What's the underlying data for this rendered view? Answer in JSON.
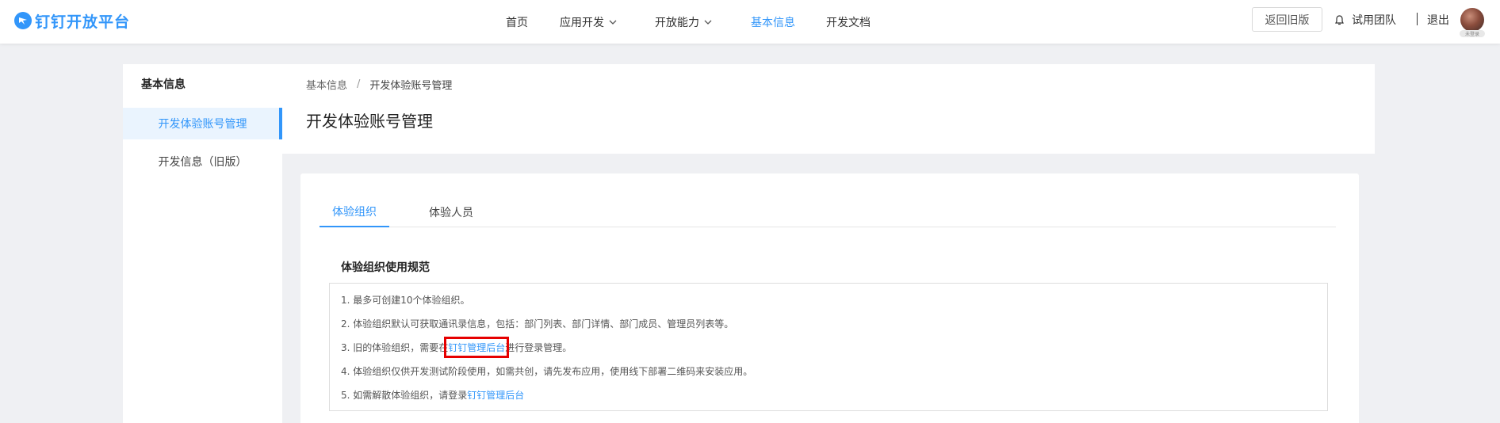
{
  "header": {
    "logo_text": "钉钉开放平台",
    "nav": [
      {
        "label": "首页",
        "dropdown": false,
        "active": false
      },
      {
        "label": "应用开发",
        "dropdown": true,
        "active": false
      },
      {
        "label": "开放能力",
        "dropdown": true,
        "active": false
      },
      {
        "label": "基本信息",
        "dropdown": false,
        "active": true
      },
      {
        "label": "开发文档",
        "dropdown": false,
        "active": false
      }
    ],
    "back_button": "返回旧版",
    "team_label": "试用团队",
    "logout_label": "退出",
    "avatar_tag": "未登录"
  },
  "sidebar": {
    "title": "基本信息",
    "items": [
      {
        "label": "开发体验账号管理",
        "active": true
      },
      {
        "label": "开发信息（旧版）",
        "active": false
      }
    ]
  },
  "page": {
    "breadcrumb": [
      "基本信息",
      "开发体验账号管理"
    ],
    "breadcrumb_separator": "/",
    "title": "开发体验账号管理"
  },
  "tabs": [
    {
      "label": "体验组织",
      "active": true
    },
    {
      "label": "体验人员",
      "active": false
    }
  ],
  "rules": {
    "title": "体验组织使用规范",
    "items": [
      {
        "text_before": "1. 最多可创建10个体验组织。",
        "link": "",
        "text_after": ""
      },
      {
        "text_before": "2. 体验组织默认可获取通讯录信息，包括：部门列表、部门详情、部门成员、管理员列表等。",
        "link": "",
        "text_after": ""
      },
      {
        "text_before": "3. 旧的体验组织，需要在",
        "link": "钉钉管理后台",
        "text_after": "进行登录管理。"
      },
      {
        "text_before": "4. 体验组织仅供开发测试阶段使用，如需共创，请先发布应用，使用线下部署二维码来安装应用。",
        "link": "",
        "text_after": ""
      },
      {
        "text_before": "5. 如需解散体验组织，请登录",
        "link": "钉钉管理后台",
        "text_after": ""
      }
    ]
  },
  "colors": {
    "accent": "#3296fa",
    "highlight": "#e60000",
    "background": "#eff0f3"
  }
}
